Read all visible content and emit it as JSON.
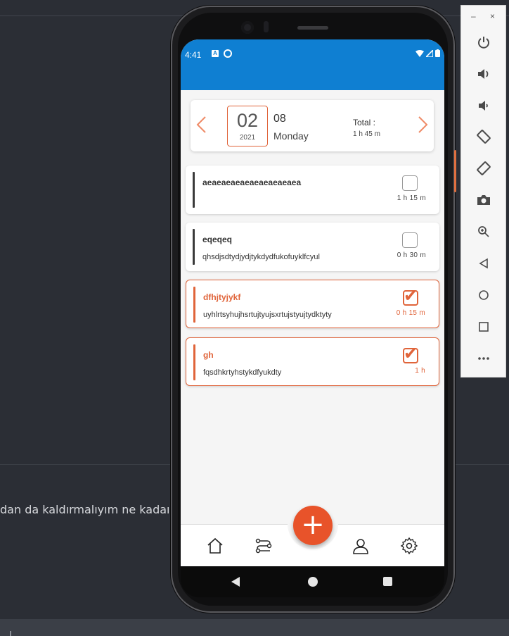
{
  "background": {
    "chat_text": "dan da kaldırmalıyım ne kadaı"
  },
  "status_bar": {
    "time": "4:41",
    "notif_letter": "A"
  },
  "date_card": {
    "day": "02",
    "year": "2021",
    "month": "08",
    "weekday": "Monday",
    "total_label": "Total :",
    "total_value": "1 h 45 m",
    "prev_icon": "chevron-left-icon",
    "next_icon": "chevron-right-icon"
  },
  "tasks": [
    {
      "title": "aeaeaeaeaeaeaeaeaeaea",
      "description": "",
      "duration": "1 h 15 m",
      "done": false
    },
    {
      "title": "eqeqeq",
      "description": "qhsdjsdtydjydjtykdydfukofuyklfcyul",
      "duration": "0 h 30 m",
      "done": false
    },
    {
      "title": "dfhjtyjykf",
      "description": "uyhlrtsyhujhsrtujtyujsxrtujstyujtydktyty",
      "duration": "0 h 15 m",
      "done": true
    },
    {
      "title": "gh",
      "description": "fqsdhkrtyhstykdfyukdty",
      "duration": "1 h",
      "done": true
    }
  ],
  "bottom_nav": {
    "items": [
      "home-icon",
      "routes-icon",
      "profile-icon",
      "settings-icon"
    ],
    "fab_icon": "plus-icon"
  },
  "emulator_panel": {
    "minimize": "–",
    "close": "×",
    "buttons": [
      "power-icon",
      "volume-up-icon",
      "volume-down-icon",
      "rotate-left-icon",
      "rotate-right-icon",
      "camera-icon",
      "zoom-icon",
      "back-icon",
      "home-circle-icon",
      "overview-icon",
      "more-icon"
    ]
  },
  "colors": {
    "app_bar": "#0f7fd2",
    "accent": "#e0643a",
    "fab": "#e8532a"
  }
}
